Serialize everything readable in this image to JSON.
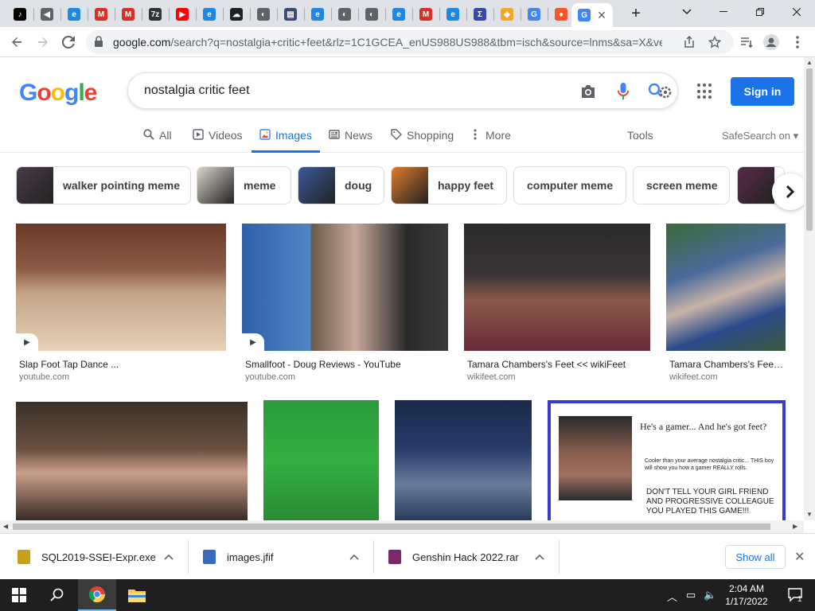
{
  "browser": {
    "tabs": [
      {
        "icon": "tiktok-icon",
        "color": "#000000",
        "glyph": "♪"
      },
      {
        "icon": "speaker-icon",
        "color": "#5f6368",
        "glyph": "◀"
      },
      {
        "icon": "edge-icon",
        "color": "#1e88e5",
        "glyph": "e"
      },
      {
        "icon": "gmail-icon",
        "color": "#d93025",
        "glyph": "M"
      },
      {
        "icon": "gmail-icon",
        "color": "#d93025",
        "glyph": "M"
      },
      {
        "icon": "7zip-icon",
        "color": "#333333",
        "glyph": "7z"
      },
      {
        "icon": "youtube-icon",
        "color": "#ff0000",
        "glyph": "▶"
      },
      {
        "icon": "edge-icon",
        "color": "#1e88e5",
        "glyph": "e"
      },
      {
        "icon": "cloud-icon",
        "color": "#202124",
        "glyph": "☁"
      },
      {
        "icon": "globe-icon",
        "color": "#5f6368",
        "glyph": "◐"
      },
      {
        "icon": "calendar-icon",
        "color": "#3c4a7a",
        "glyph": "▤"
      },
      {
        "icon": "edge-icon",
        "color": "#1e88e5",
        "glyph": "e"
      },
      {
        "icon": "globe-icon",
        "color": "#5f6368",
        "glyph": "◐"
      },
      {
        "icon": "globe-icon",
        "color": "#5f6368",
        "glyph": "◐"
      },
      {
        "icon": "edge-icon",
        "color": "#1e88e5",
        "glyph": "e"
      },
      {
        "icon": "gmail-icon",
        "color": "#d93025",
        "glyph": "M"
      },
      {
        "icon": "edge-icon",
        "color": "#1e88e5",
        "glyph": "e"
      },
      {
        "icon": "sigma-icon",
        "color": "#3949ab",
        "glyph": "Σ"
      },
      {
        "icon": "diamond-icon",
        "color": "#f5a623",
        "glyph": "◆"
      },
      {
        "icon": "google-icon",
        "color": "#4285f4",
        "glyph": "G"
      },
      {
        "icon": "brave-icon",
        "color": "#fb542b",
        "glyph": "●"
      },
      {
        "icon": "google-icon",
        "color": "#4285f4",
        "glyph": "G",
        "active": true
      }
    ],
    "close_tab": "✕",
    "new_tab": "+",
    "url_host": "google.com",
    "url_rest": "/search?q=nostalgia+critic+feet&rlz=1C1GCEA_enUS988US988&tbm=isch&source=lnms&sa=X&ve..."
  },
  "google": {
    "logo": [
      "G",
      "o",
      "o",
      "g",
      "l",
      "e"
    ],
    "logo_colors": [
      "#4285f4",
      "#ea4335",
      "#fbbc05",
      "#4285f4",
      "#34a853",
      "#ea4335"
    ],
    "query": "nostalgia critic feet",
    "sign_in": "Sign in",
    "nav": [
      {
        "label": "All",
        "icon": "search-icon"
      },
      {
        "label": "Videos",
        "icon": "video-icon"
      },
      {
        "label": "Images",
        "icon": "image-icon",
        "active": true
      },
      {
        "label": "News",
        "icon": "news-icon"
      },
      {
        "label": "Shopping",
        "icon": "tag-icon"
      },
      {
        "label": "More",
        "icon": "more-vert-icon"
      }
    ],
    "tools": "Tools",
    "safesearch": "SafeSearch on ▾",
    "chips": [
      {
        "label": "walker pointing meme",
        "thumb": "#4a3a48"
      },
      {
        "label": "meme",
        "thumb": "#d9d4cc"
      },
      {
        "label": "doug",
        "thumb": "#3a5a9a"
      },
      {
        "label": "happy feet",
        "thumb": "#e07a2a"
      },
      {
        "label": "computer meme",
        "thumb": null
      },
      {
        "label": "screen meme",
        "thumb": null
      },
      {
        "label": "",
        "thumb": "#5a2a4a"
      }
    ],
    "results": [
      {
        "title": "Slap Foot Tap Dance ...",
        "source": "youtube.com",
        "video": true,
        "bg": "linear-gradient(180deg,#6a3a28 0%,#8a5a44 35%,#c4a488 55%,#e6d2b8 100%)"
      },
      {
        "title": "Smallfoot - Doug Reviews - YouTube",
        "source": "youtube.com",
        "video": true,
        "bg": "linear-gradient(90deg,#2f5fa8 0%,#4f86c8 33%,#6a5a4a 34%,#c8a89a 55%,#2a2a2a 80%,#3a3a3a 100%)"
      },
      {
        "title": "Tamara Chambers's Feet << wikiFeet",
        "source": "wikifeet.com",
        "video": false,
        "bg": "linear-gradient(180deg,#2a2a2a 0%,#3a3536 40%,#8a5a4a 60%,#6a2a3a 100%)"
      },
      {
        "title": "Tamara Chambers's Feet << ...",
        "source": "wikifeet.com",
        "video": false,
        "bg": "linear-gradient(160deg,#3a6a3a 0%,#4a6a9a 35%,#c8b4a8 55%,#2a4a8a 75%,#3a5a3a 100%)"
      },
      {
        "title": "",
        "source": "",
        "video": false,
        "bg": "linear-gradient(180deg,#3a3028 0%,#6a5040 40%,#c8a08a 60%,#3a2a24 100%)"
      },
      {
        "title": "",
        "source": "",
        "video": false,
        "bg": "linear-gradient(180deg,#2a9a3a 0%,#34b040 50%,#2a8a34 100%)"
      },
      {
        "title": "",
        "source": "",
        "video": false,
        "bg": "linear-gradient(180deg,#1a2a4a 0%,#2a3a6a 40%,#6a7a9a 70%,#2a3a5a 100%)"
      },
      {
        "title": "",
        "source": "",
        "video": false,
        "meme": true,
        "bg": "#ffffff"
      }
    ],
    "meme_text": {
      "heading": "He's a gamer... And he's got feet?",
      "sub": "Cooler than your average nostalgia critic... THIS boy will show you how a gamer REALLY rolls.",
      "big": "DON'T TELL YOUR GIRL FRIEND AND PROGRESSIVE COLLEAGUE YOU PLAYED THIS GAME!!!"
    }
  },
  "downloads": {
    "items": [
      {
        "name": "SQL2019-SSEI-Expr.exe",
        "icon": "installer-icon",
        "color": "#c8a020"
      },
      {
        "name": "images.jfif",
        "icon": "image-file-icon",
        "color": "#3a6ab8"
      },
      {
        "name": "Genshin Hack 2022.rar",
        "icon": "archive-icon",
        "color": "#7a2a6a"
      }
    ],
    "show_all": "Show all",
    "close": "✕"
  },
  "taskbar": {
    "time": "2:04 AM",
    "date": "1/17/2022",
    "notification_count": "1"
  }
}
